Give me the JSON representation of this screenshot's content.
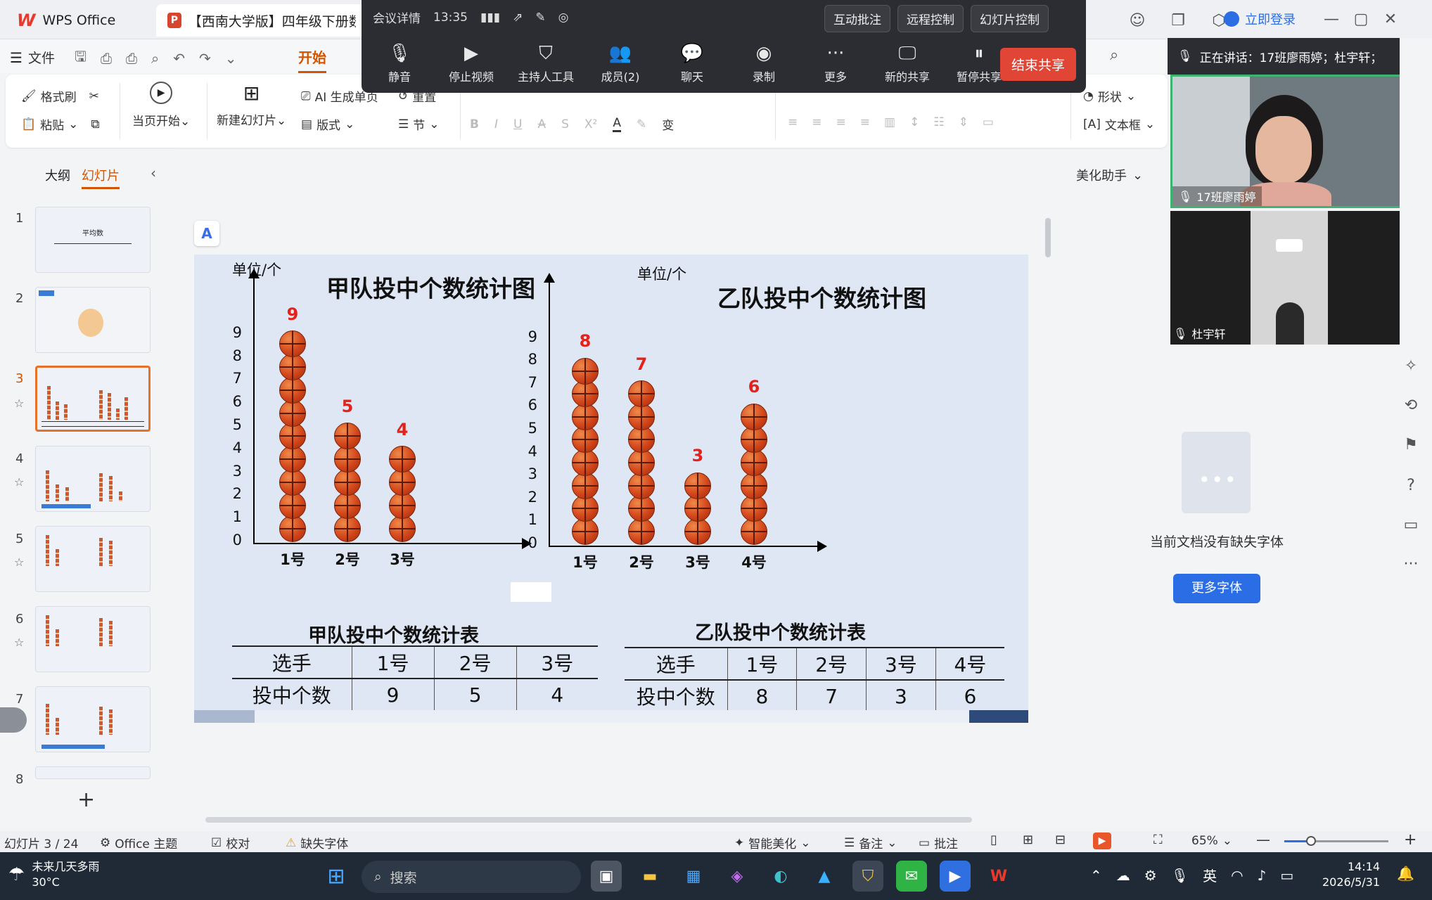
{
  "titlebar": {
    "app_name": "WPS Office",
    "doc_tab": "【西南大学版】四年级下册数学",
    "login": "立即登录"
  },
  "menu": {
    "file": "文件",
    "active_tab": "开始"
  },
  "ribbon": {
    "format_painter": "格式刷",
    "paste": "粘贴",
    "play_from_current": "当页开始",
    "new_slide": "新建幻灯片",
    "ai_generate": "AI 生成单页",
    "layout": "版式",
    "reset": "重置",
    "section": "节",
    "shape": "形状",
    "textbox": "文本框"
  },
  "meeting": {
    "details": "会议详情",
    "time": "13:35",
    "annotate": "互动批注",
    "remote": "远程控制",
    "slide_control": "幻灯片控制",
    "tools": [
      "静音",
      "停止视频",
      "主持人工具",
      "成员(2)",
      "聊天",
      "录制",
      "更多",
      "新的共享",
      "暂停共享"
    ],
    "end_share": "结束共享"
  },
  "panel": {
    "outline": "大纲",
    "slides": "幻灯片",
    "numbers": [
      "1",
      "2",
      "3",
      "4",
      "5",
      "6",
      "7",
      "8"
    ],
    "thumb1_title": "平均数",
    "add": "+"
  },
  "speaking": "正在讲话：17班廖雨婷；杜宇轩；",
  "participants": [
    "17班廖雨婷",
    "杜宇轩"
  ],
  "beautify": "美化助手",
  "font_panel": {
    "message": "当前文档没有缺失字体",
    "button": "更多字体"
  },
  "slide": {
    "chart_a": {
      "title": "甲队投中个数统计图",
      "unit": "单位/个"
    },
    "chart_b": {
      "title": "乙队投中个数统计图",
      "unit": "单位/个"
    },
    "y_ticks": [
      "0",
      "1",
      "2",
      "3",
      "4",
      "5",
      "6",
      "7",
      "8",
      "9"
    ],
    "table_a": {
      "title": "甲队投中个数统计表",
      "header": [
        "选手",
        "1号",
        "2号",
        "3号"
      ],
      "row": [
        "投中个数",
        "9",
        "5",
        "4"
      ]
    },
    "table_b": {
      "title": "乙队投中个数统计表",
      "header": [
        "选手",
        "1号",
        "2号",
        "3号",
        "4号"
      ],
      "row": [
        "投中个数",
        "8",
        "7",
        "3",
        "6"
      ]
    }
  },
  "chart_data": [
    {
      "type": "bar",
      "title": "甲队投中个数统计图",
      "ylabel": "单位/个",
      "categories": [
        "1号",
        "2号",
        "3号"
      ],
      "values": [
        9,
        5,
        4
      ],
      "ylim": [
        0,
        9
      ]
    },
    {
      "type": "bar",
      "title": "乙队投中个数统计图",
      "ylabel": "单位/个",
      "categories": [
        "1号",
        "2号",
        "3号",
        "4号"
      ],
      "values": [
        8,
        7,
        3,
        6
      ],
      "ylim": [
        0,
        9
      ]
    }
  ],
  "status": {
    "slide_pos": "幻灯片 3 / 24",
    "theme": "Office 主题",
    "proofread": "校对",
    "missing_font": "缺失字体",
    "smart": "智能美化",
    "notes": "备注",
    "comment": "批注",
    "zoom": "65%"
  },
  "taskbar": {
    "weather_title": "未来几天多雨",
    "weather_temp": "30°C",
    "search": "搜索",
    "ime": "英",
    "clock_time": "14:14",
    "clock_date": "2026/5/31"
  }
}
